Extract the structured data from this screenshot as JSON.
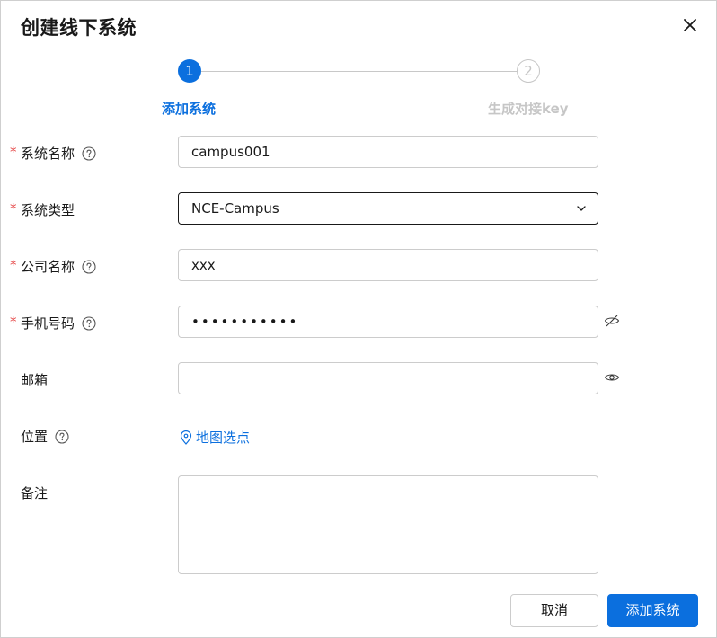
{
  "dialog": {
    "title": "创建线下系统",
    "close_icon": "close-icon"
  },
  "steps": [
    {
      "number": "1",
      "label": "添加系统",
      "state": "active"
    },
    {
      "number": "2",
      "label": "生成对接key",
      "state": "pending"
    }
  ],
  "form": {
    "required_mark": "*",
    "system_name": {
      "label": "系统名称",
      "value": "campus001",
      "required": true,
      "help_icon": "question-circle-icon"
    },
    "system_type": {
      "label": "系统类型",
      "value": "NCE-Campus",
      "required": true,
      "caret_icon": "chevron-down-icon"
    },
    "company_name": {
      "label": "公司名称",
      "value": "xxx",
      "required": true,
      "help_icon": "question-circle-icon"
    },
    "phone": {
      "label": "手机号码",
      "value": "•••••••••••",
      "required": true,
      "help_icon": "question-circle-icon",
      "toggle_icon": "eye-off-icon"
    },
    "email": {
      "label": "邮箱",
      "value": "",
      "required": false,
      "toggle_icon": "eye-icon"
    },
    "location": {
      "label": "位置",
      "link_text": "地图选点",
      "help_icon": "question-circle-icon",
      "link_icon": "map-pin-icon"
    },
    "remark": {
      "label": "备注",
      "value": ""
    }
  },
  "footer": {
    "cancel_label": "取消",
    "submit_label": "添加系统"
  },
  "colors": {
    "primary": "#0b6fde",
    "required": "#e54545",
    "disabled": "#c6c6c6"
  }
}
